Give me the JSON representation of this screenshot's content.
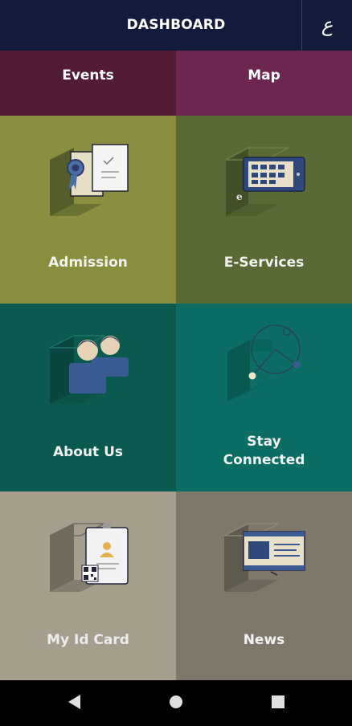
{
  "header": {
    "title": "DASHBOARD",
    "lang_glyph": "ع"
  },
  "tabs": [
    {
      "label": "Events"
    },
    {
      "label": "Map"
    }
  ],
  "tiles": [
    {
      "label": "Admission"
    },
    {
      "label": "E-Services"
    },
    {
      "label": "About Us"
    },
    {
      "label_line1": "Stay",
      "label_line2": "Connected"
    },
    {
      "label": "My Id Card"
    },
    {
      "label": "News"
    }
  ],
  "colors": {
    "header": "#131b3b",
    "events": "#521c37",
    "map": "#6d2650",
    "admission": "#8a8f3f",
    "eservices": "#5a6a35",
    "aboutus": "#0a5a50",
    "stayconnected": "#0b6d63",
    "idcard": "#a59e8c",
    "news": "#7d7869"
  },
  "icons": {
    "admission": "certificate-icon",
    "eservices": "e-services-card-icon",
    "aboutus": "people-icon",
    "stayconnected": "network-icon",
    "idcard": "id-card-icon",
    "news": "news-screen-icon"
  }
}
